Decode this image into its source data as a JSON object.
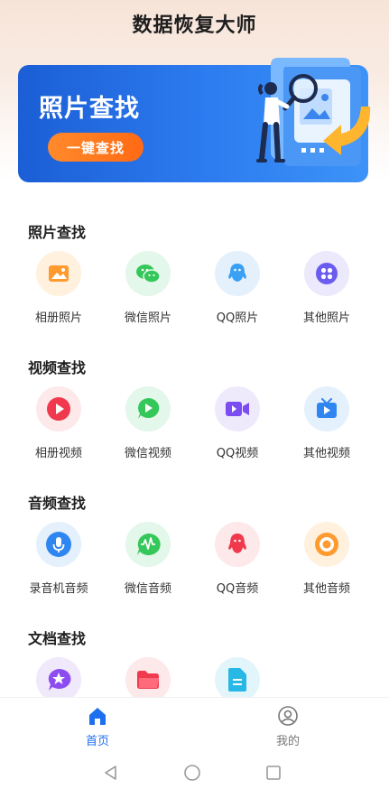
{
  "app": {
    "title": "数据恢复大师"
  },
  "banner": {
    "title": "照片查找",
    "button_label": "一键查找"
  },
  "sections": [
    {
      "title": "照片查找",
      "items": [
        {
          "label": "相册照片",
          "icon": "photo-album-icon",
          "bg": "#fff1de",
          "fg": "#ff9a2e"
        },
        {
          "label": "微信照片",
          "icon": "wechat-icon",
          "bg": "#e3f7ea",
          "fg": "#34c759"
        },
        {
          "label": "QQ照片",
          "icon": "qq-icon",
          "bg": "#e4f0fc",
          "fg": "#3aa0f3"
        },
        {
          "label": "其他照片",
          "icon": "four-dots-icon",
          "bg": "#ebe9fb",
          "fg": "#6b5cf0"
        }
      ]
    },
    {
      "title": "视频查找",
      "items": [
        {
          "label": "相册视频",
          "icon": "play-circle-icon",
          "bg": "#fde8ea",
          "fg": "#f0394d"
        },
        {
          "label": "微信视频",
          "icon": "wechat-video-icon",
          "bg": "#e3f7ea",
          "fg": "#34c759"
        },
        {
          "label": "QQ视频",
          "icon": "video-camera-icon",
          "bg": "#eeeafc",
          "fg": "#7a4cf2"
        },
        {
          "label": "其他视频",
          "icon": "tv-icon",
          "bg": "#e4f0fc",
          "fg": "#2f86f0"
        }
      ]
    },
    {
      "title": "音频查找",
      "items": [
        {
          "label": "录音机音频",
          "icon": "microphone-icon",
          "bg": "#e4f0fc",
          "fg": "#2f86f0"
        },
        {
          "label": "微信音频",
          "icon": "waveform-icon",
          "bg": "#e3f7ea",
          "fg": "#34c759"
        },
        {
          "label": "QQ音频",
          "icon": "qq-audio-icon",
          "bg": "#fde8ea",
          "fg": "#f0394d"
        },
        {
          "label": "其他音频",
          "icon": "record-icon",
          "bg": "#fff1de",
          "fg": "#ff9a2e"
        }
      ]
    },
    {
      "title": "文档查找",
      "items": [
        {
          "label": "",
          "icon": "star-chat-icon",
          "bg": "#efe9fb",
          "fg": "#8d4cf0"
        },
        {
          "label": "",
          "icon": "folder-icon",
          "bg": "#fde8ea",
          "fg": "#f0394d"
        },
        {
          "label": "",
          "icon": "document-icon",
          "bg": "#e2f5fb",
          "fg": "#28b8e6"
        }
      ]
    }
  ],
  "tabbar": {
    "home_label": "首页",
    "mine_label": "我的",
    "active_color": "#1e6ff0",
    "inactive_color": "#777777"
  }
}
